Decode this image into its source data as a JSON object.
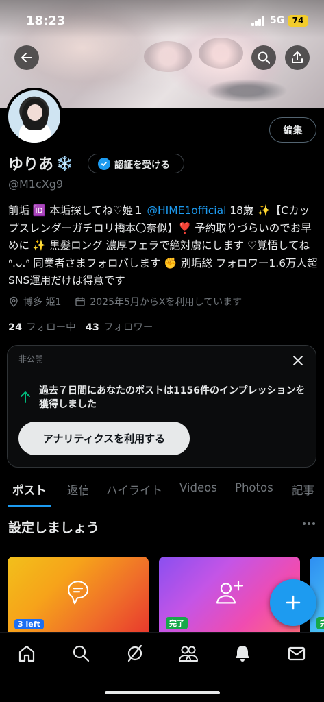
{
  "status_bar": {
    "time": "18:23",
    "network": "5G",
    "battery": "74"
  },
  "profile": {
    "name": "ゆりあ",
    "name_emoji": "❄️",
    "verify_label": "認証を受ける",
    "handle": "@M1cXg9",
    "edit_label": "編集",
    "bio": {
      "part1": "前垢 🆔 本垢探してね♡姫１ ",
      "mention": "@HIME1official",
      "part2": " 18歳 ✨【Cカップスレンダーガチロリ橋本〇奈似】❣️ 予約取りづらいのでお早めに ✨ 黒髪ロング 濃厚フェラで絶対虜にします ♡覚悟してね ᐢ.ᴗ.ᐢ 同業者さまフォロバします ✊ 別垢総 フォロワー1.6万人超SNS運用だけは得意です"
    },
    "location": "博多 姫1",
    "joined": "2025年5月からXを利用しています",
    "following_count": "24",
    "following_label": "フォロー中",
    "followers_count": "43",
    "followers_label": "フォロワー"
  },
  "analytics_card": {
    "private_label": "非公開",
    "impressions_text": "過去７日間にあなたのポストは1156件のインプレッションを獲得しました",
    "button_label": "アナリティクスを利用する"
  },
  "tabs": [
    {
      "label": "ポスト",
      "active": true
    },
    {
      "label": "返信",
      "active": false
    },
    {
      "label": "ハイライト",
      "active": false
    },
    {
      "label": "Videos",
      "active": false
    },
    {
      "label": "Photos",
      "active": false
    },
    {
      "label": "記事",
      "active": false
    }
  ],
  "setup": {
    "title": "設定しましょう",
    "tiles": [
      {
        "badge": "3 left",
        "icon": "chat-bubble-icon"
      },
      {
        "badge": "完了",
        "icon": "add-user-icon"
      },
      {
        "badge": "完",
        "icon": ""
      }
    ]
  },
  "bottom_nav": [
    "home-icon",
    "search-icon",
    "grok-icon",
    "communities-icon",
    "notifications-icon",
    "messages-icon"
  ],
  "colors": {
    "accent": "#1d9bf0",
    "background": "#000000",
    "muted": "#71767b",
    "green": "#00ba7c"
  }
}
